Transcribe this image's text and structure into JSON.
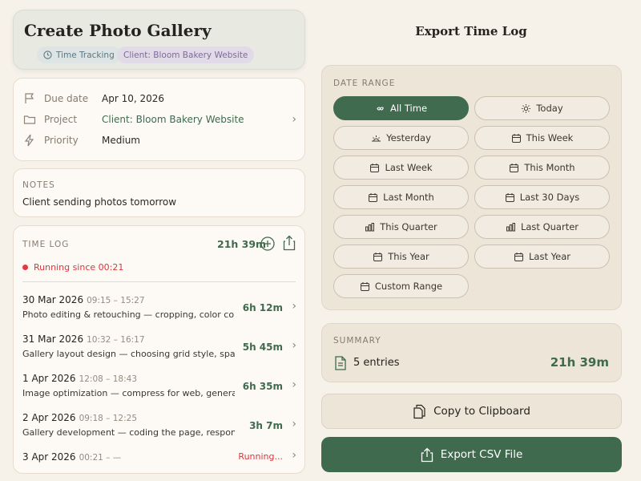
{
  "task": {
    "title": "Create Photo Gallery",
    "chips": {
      "tracking": "Time Tracking",
      "client": "Client: Bloom Bakery Website"
    }
  },
  "details": {
    "due_label": "Due date",
    "due_value": "Apr 10, 2026",
    "project_label": "Project",
    "project_value": "Client: Bloom Bakery Website",
    "priority_label": "Priority",
    "priority_value": "Medium"
  },
  "notes": {
    "label": "NOTES",
    "text": "Client sending photos tomorrow"
  },
  "time_log": {
    "label": "TIME LOG",
    "total": "21h 39m",
    "running_text": "Running since 00:21",
    "entries": [
      {
        "date": "30 Mar 2026",
        "times": "09:15 – 15:27",
        "desc": "Photo editing & retouching — cropping, color corre...",
        "duration": "6h 12m"
      },
      {
        "date": "31 Mar 2026",
        "times": "10:32 – 16:17",
        "desc": "Gallery layout design — choosing grid style, spaci...",
        "duration": "5h 45m"
      },
      {
        "date": "1 Apr 2026",
        "times": "12:08 – 18:43",
        "desc": "Image optimization — compress for web, generate...",
        "duration": "6h 35m"
      },
      {
        "date": "2 Apr 2026",
        "times": "09:18 – 12:25",
        "desc": "Gallery development — coding the page, responsive...",
        "duration": "3h 7m"
      },
      {
        "date": "3 Apr 2026",
        "times": "00:21 – —",
        "desc": "",
        "duration": "Running..."
      }
    ]
  },
  "export": {
    "title": "Export Time Log",
    "range_label": "DATE RANGE",
    "ranges": [
      {
        "label": "All Time",
        "icon": "infinity-icon",
        "selected": true
      },
      {
        "label": "Today",
        "icon": "sun-icon",
        "selected": false
      },
      {
        "label": "Yesterday",
        "icon": "sunset-icon",
        "selected": false
      },
      {
        "label": "This Week",
        "icon": "calendar-icon",
        "selected": false
      },
      {
        "label": "Last Week",
        "icon": "calendar-icon",
        "selected": false
      },
      {
        "label": "This Month",
        "icon": "calendar-icon",
        "selected": false
      },
      {
        "label": "Last Month",
        "icon": "calendar-icon",
        "selected": false
      },
      {
        "label": "Last 30 Days",
        "icon": "calendar-icon",
        "selected": false
      },
      {
        "label": "This Quarter",
        "icon": "bar-chart-icon",
        "selected": false
      },
      {
        "label": "Last Quarter",
        "icon": "bar-chart-icon",
        "selected": false
      },
      {
        "label": "This Year",
        "icon": "calendar-icon",
        "selected": false
      },
      {
        "label": "Last Year",
        "icon": "calendar-icon",
        "selected": false
      },
      {
        "label": "Custom Range",
        "icon": "calendar-icon",
        "selected": false
      }
    ],
    "summary_label": "SUMMARY",
    "summary_entries": "5 entries",
    "summary_total": "21h 39m",
    "copy_label": "Copy to Clipboard",
    "export_label": "Export CSV File"
  },
  "colors": {
    "accent": "#3f6a4e",
    "running": "#d9363e",
    "background": "#f6f1e9"
  }
}
